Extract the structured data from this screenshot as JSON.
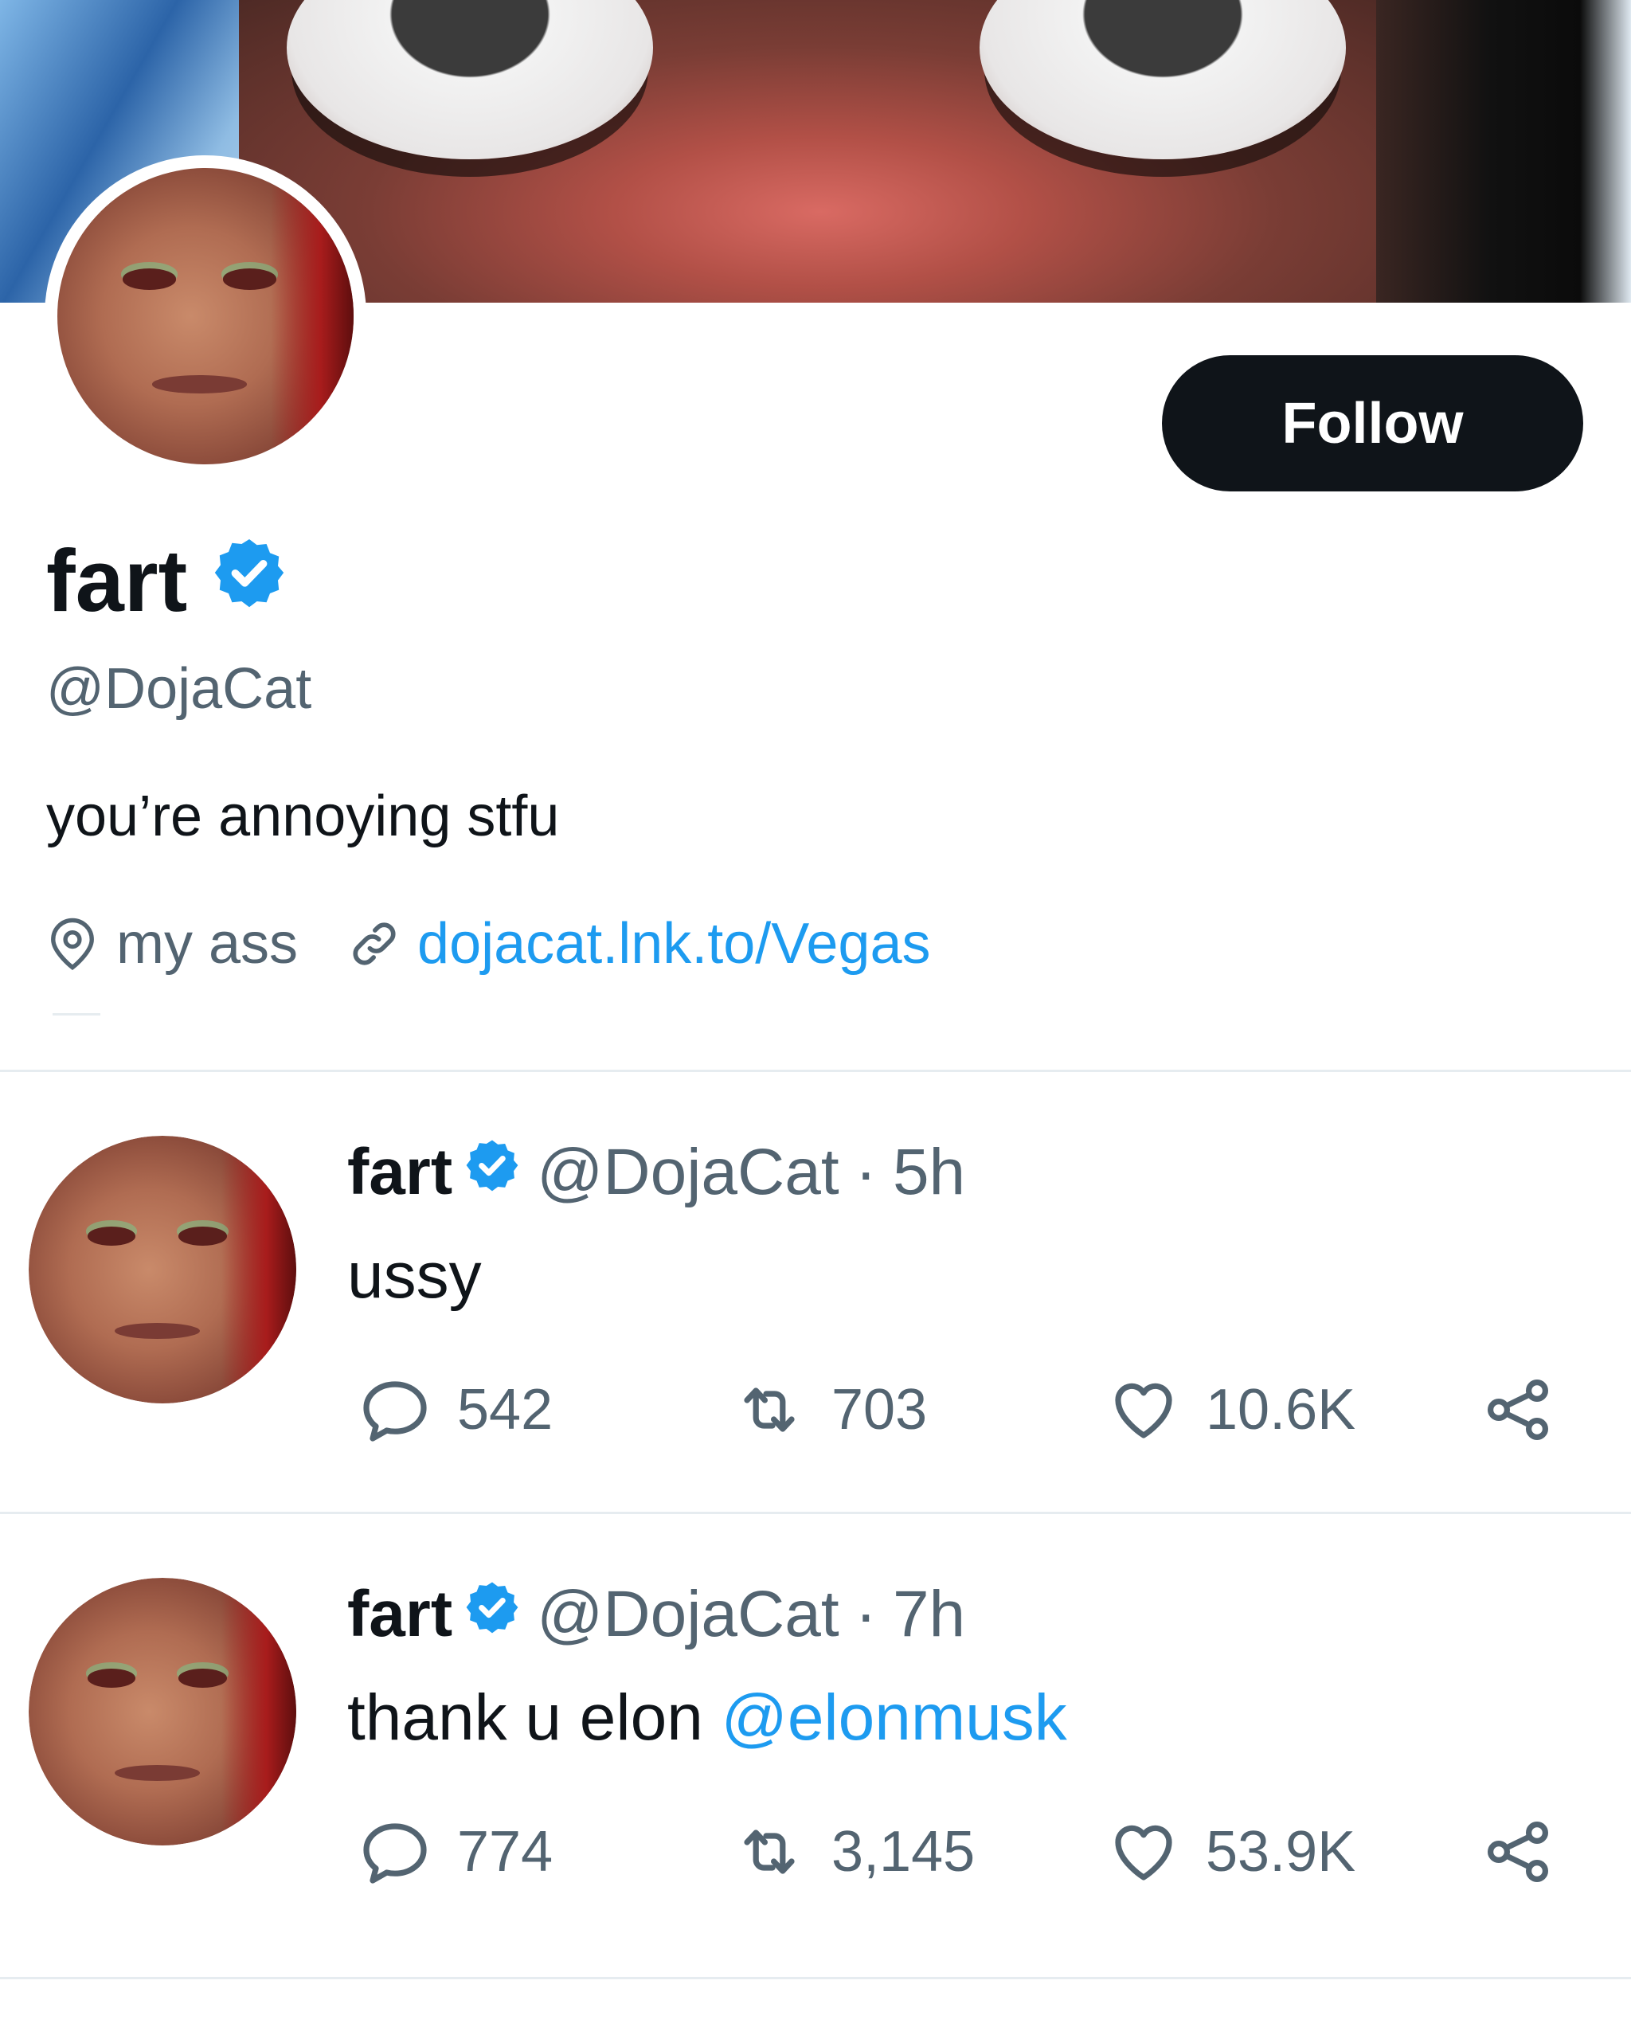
{
  "profile": {
    "name": "fart",
    "handle": "@DojaCat",
    "bio": "you’re annoying stfu",
    "location": "my ass",
    "website": "dojacat.lnk.to/Vegas",
    "follow_label": "Follow",
    "verified_color": "#1d9bf0"
  },
  "tweets": [
    {
      "name": "fart",
      "handle": "@DojaCat",
      "separator": "·",
      "time": "5h",
      "text": "ussy",
      "mention": "",
      "replies": "542",
      "retweets": "703",
      "likes": "10.6K"
    },
    {
      "name": "fart",
      "handle": "@DojaCat",
      "separator": "·",
      "time": "7h",
      "text": "thank u elon ",
      "mention": "@elonmusk",
      "replies": "774",
      "retweets": "3,145",
      "likes": "53.9K"
    }
  ],
  "colors": {
    "text": "#0f1419",
    "secondary": "#536471",
    "link": "#1d9bf0",
    "divider": "#e6ecf0",
    "button": "#0f1419"
  },
  "icons": [
    "verified-badge-icon",
    "location-pin-icon",
    "link-icon",
    "reply-icon",
    "retweet-icon",
    "like-icon",
    "share-icon"
  ]
}
